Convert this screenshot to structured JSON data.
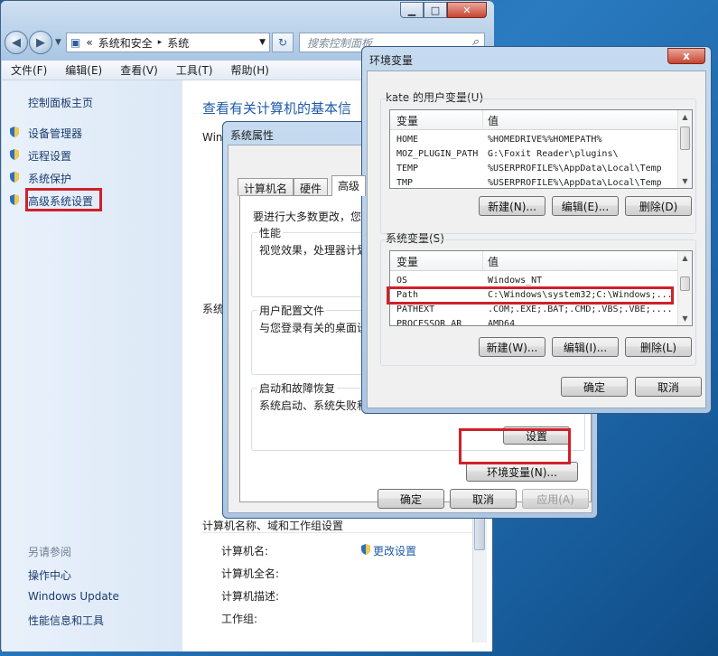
{
  "control_panel": {
    "address_chevron": "«",
    "breadcrumb_1": "系统和安全",
    "breadcrumb_sep": "▸",
    "breadcrumb_2": "系统",
    "search_placeholder": "搜索控制面板",
    "menu": [
      "文件(F)",
      "编辑(E)",
      "查看(V)",
      "工具(T)",
      "帮助(H)"
    ],
    "left_pane": {
      "home": "控制面板主页",
      "links": [
        "设备管理器",
        "远程设置",
        "系统保护",
        "高级系统设置"
      ],
      "see_also": "另请参阅",
      "see_also_links": [
        "操作中心",
        "Windows Update",
        "性能信息和工具"
      ]
    },
    "content": {
      "heading": "查看有关计算机的基本信",
      "win_stub": "Win",
      "sys_stub": "系统",
      "section_title": "计算机名称、域和工作组设置",
      "change_settings": "更改设置",
      "fields": [
        "计算机名:",
        "计算机全名:",
        "计算机描述:",
        "工作组:"
      ]
    }
  },
  "system_properties": {
    "title": "系统属性",
    "tabs": [
      "计算机名",
      "硬件",
      "高级"
    ],
    "admin_note": "要进行大多数更改，您",
    "performance": {
      "label": "性能",
      "text": "视觉效果，处理器计划"
    },
    "user_profiles": {
      "label": "用户配置文件",
      "text": "与您登录有关的桌面设"
    },
    "startup": {
      "label": "启动和故障恢复",
      "text": "系统启动、系统失败和"
    },
    "startup_settings_btn": "设置",
    "env_btn": "环境变量(N)...",
    "ok": "确定",
    "cancel": "取消",
    "apply": "应用(A)"
  },
  "env_vars": {
    "title": "环境变量",
    "close_glyph": "x",
    "user_section": "kate 的用户变量(U)",
    "col_var": "变量",
    "col_val": "值",
    "user_vars": [
      {
        "name": "HOME",
        "value": "%HOMEDRIVE%%HOMEPATH%"
      },
      {
        "name": "MOZ_PLUGIN_PATH",
        "value": "G:\\Foxit Reader\\plugins\\"
      },
      {
        "name": "TEMP",
        "value": "%USERPROFILE%\\AppData\\Local\\Temp"
      },
      {
        "name": "TMP",
        "value": "%USERPROFILE%\\AppData\\Local\\Temp"
      }
    ],
    "system_section": "系统变量(S)",
    "system_vars": [
      {
        "name": "OS",
        "value": "Windows_NT"
      },
      {
        "name": "Path",
        "value": "C:\\Windows\\system32;C:\\Windows;..."
      },
      {
        "name": "PATHEXT",
        "value": ".COM;.EXE;.BAT;.CMD;.VBS;.VBE;...."
      },
      {
        "name": "PROCESSOR_AR",
        "value": "AMD64"
      }
    ],
    "new_user": "新建(N)...",
    "edit_user": "编辑(E)...",
    "delete_user": "删除(D)",
    "new_sys": "新建(W)...",
    "edit_sys": "编辑(I)...",
    "delete_sys": "删除(L)",
    "ok": "确定",
    "cancel": "取消"
  },
  "colors": {
    "highlight_red": "#d0202a",
    "link_blue": "#1b3c6e",
    "heading_blue": "#1e5aa8"
  }
}
